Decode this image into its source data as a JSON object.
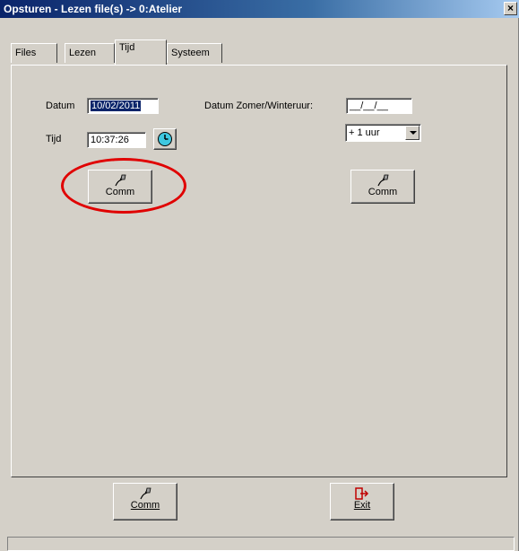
{
  "window": {
    "title": "Opsturen - Lezen file(s) -> 0:Atelier",
    "close_label": "×"
  },
  "tabs": [
    {
      "label": "Files",
      "active": false
    },
    {
      "label": "Lezen",
      "active": false
    },
    {
      "label": "Tijd",
      "active": true
    },
    {
      "label": "Systeem",
      "active": false
    }
  ],
  "tijd_tab": {
    "datum_label": "Datum",
    "datum_value": "10/02/2011",
    "tijd_label": "Tijd",
    "tijd_value": "10:37:26",
    "dst_label": "Datum Zomer/Winteruur:",
    "dst_value": "__/__/__",
    "offset_selected": "+ 1 uur",
    "comm_left_label": "Comm",
    "comm_right_label": "Comm"
  },
  "footer": {
    "comm_label": "Comm",
    "exit_label": "Exit"
  },
  "colors": {
    "annotation": "#e00000",
    "titlebar": "#0a246a",
    "clock": "#3ec8e0"
  },
  "icons": {
    "comm": "plug-icon",
    "exit": "exit-door-icon",
    "clock": "clock-icon"
  }
}
